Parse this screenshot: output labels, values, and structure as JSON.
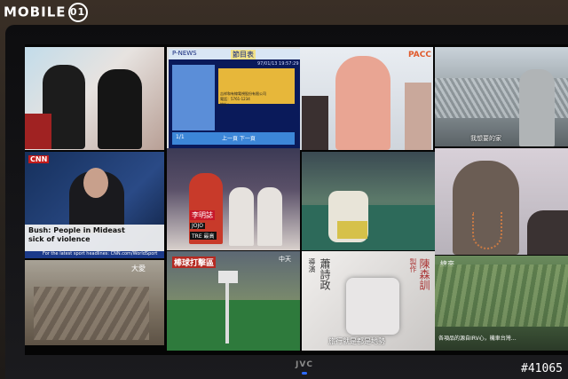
{
  "watermark": {
    "site": "MOBILE",
    "badge": "01",
    "id": "#41065"
  },
  "tv": {
    "brand": "JVC"
  },
  "channels": {
    "epg": {
      "header": "P-NEWS",
      "title": "節目表",
      "date": "97/01/13 19:57:29",
      "box_text": "吉祥和有線電視股份有限公司\n電話：5761-1234\n地址：",
      "footer_left": "1/1",
      "footer_bar": "上一頁 下一頁"
    },
    "pacc": {
      "logo": "PACC"
    },
    "caption_right": "我想要的家",
    "cnn": {
      "logo": "CNN",
      "ticker_top": "Bush: People in Mideast",
      "ticker_bottom": "sick of violence",
      "ticker_small": "Abu Dhabi, United Arab Emirates",
      "ticker_strip": "For the latest sport headlines: CNN.com/WorldSport"
    },
    "variety": {
      "name_tag": "李明誌",
      "show_tag": "JOJO",
      "show_tag2": "TRE 最高"
    },
    "drama1": {
      "logo": "大愛"
    },
    "baseball": {
      "title": "棒球打擊區",
      "logo": "中天"
    },
    "drama2": {
      "credit1": "導演",
      "credit1_name": "蕭詩政",
      "credit2": "製作",
      "credit2_name": "陳森訓",
      "subtitle": "旅行就是都是地勢"
    },
    "nature": {
      "logo": "緯來",
      "caption": "各項品的源自IRV心，機車台灣…"
    }
  }
}
